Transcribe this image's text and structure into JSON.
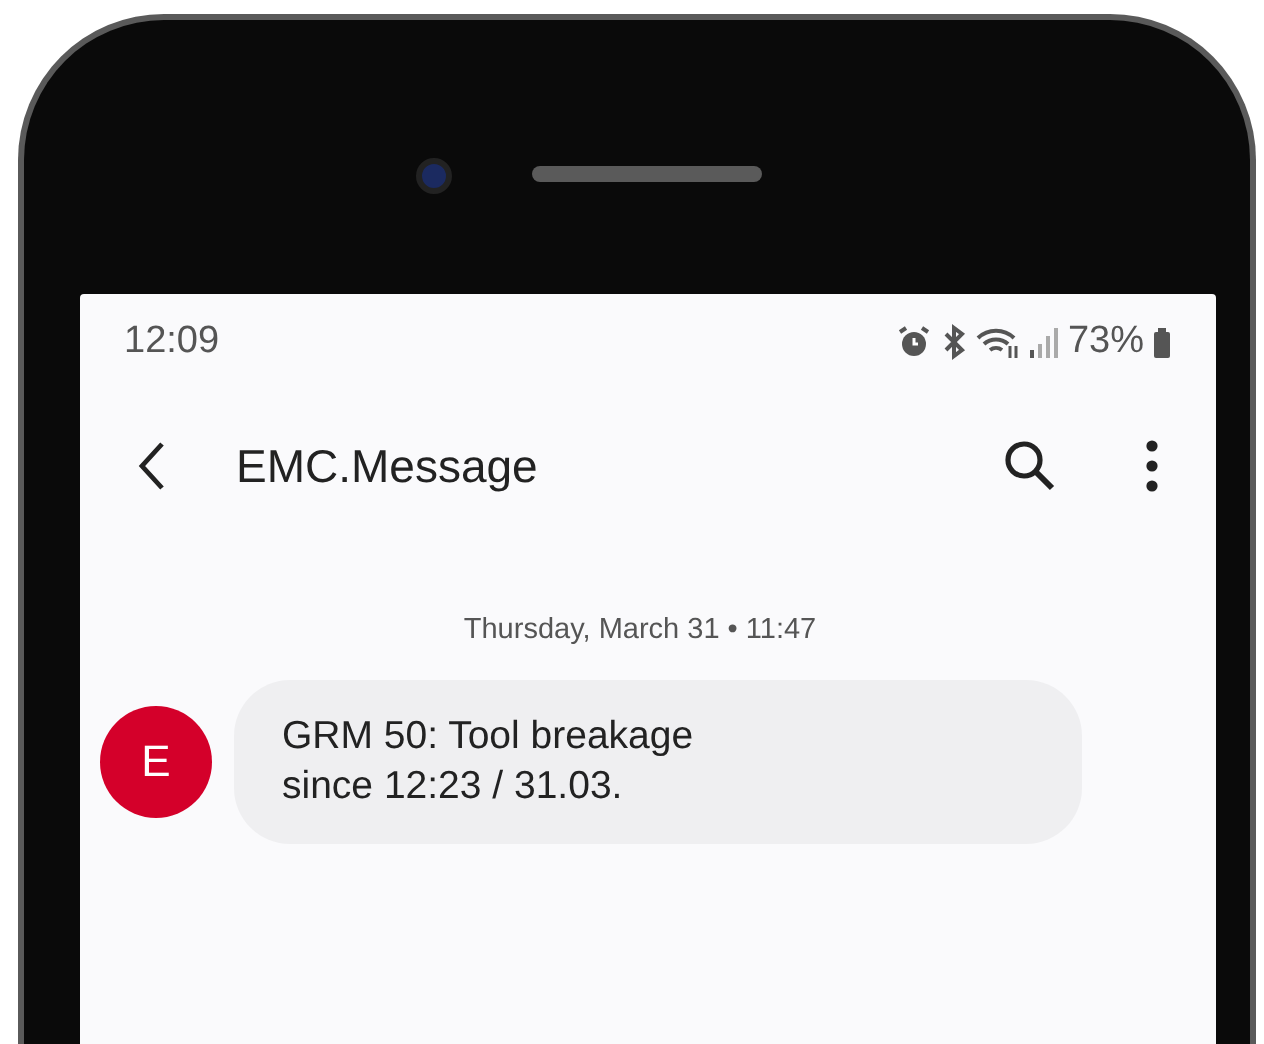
{
  "status_bar": {
    "time": "12:09",
    "battery": "73%"
  },
  "header": {
    "title": "EMC.Message"
  },
  "conversation": {
    "date_label": "Thursday, March 31 • 11:47",
    "messages": [
      {
        "avatar": "E",
        "text": "GRM 50: Tool breakage\nsince 12:23 / 31.03."
      }
    ]
  }
}
